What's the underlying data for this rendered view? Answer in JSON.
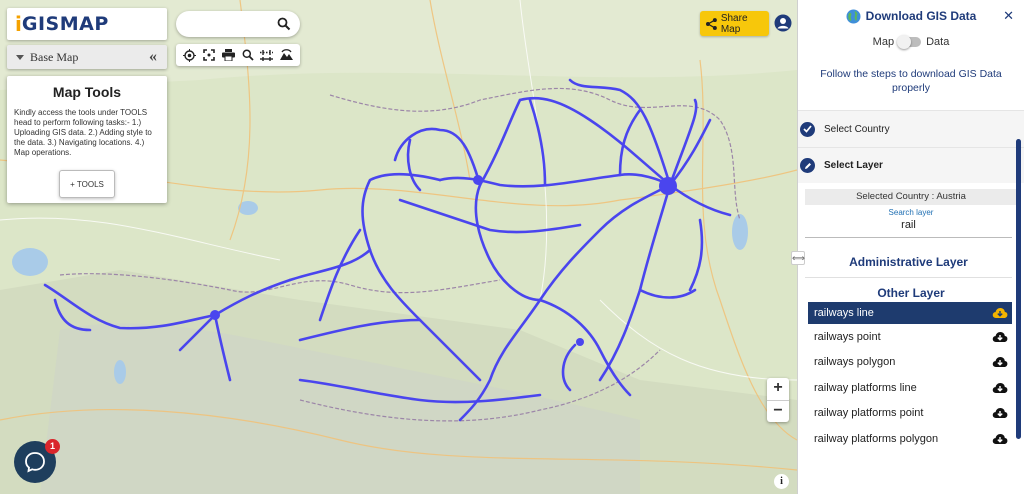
{
  "logo": {
    "mark": "i",
    "text": "GISMAP"
  },
  "base_map": {
    "label": "Base Map",
    "collapse_glyph": "«"
  },
  "map_tools": {
    "title": "Map Tools",
    "description": "Kindly access the tools under TOOLS head to perform following tasks:- 1.) Uploading GIS data. 2.) Adding style to the data. 3.) Navigating locations. 4.) Map operations.",
    "button_label": "+ TOOLS"
  },
  "search": {
    "placeholder": "",
    "value": ""
  },
  "toolbar": {
    "icons": [
      "locate-icon",
      "fullscreen-icon",
      "print-icon",
      "zoom-search-icon",
      "measure-icon",
      "terrain-icon"
    ]
  },
  "share": {
    "label": "Share Map"
  },
  "zoom": {
    "in": "+",
    "out": "−"
  },
  "info": "i",
  "chat": {
    "badge": "1"
  },
  "panel": {
    "title": "Download GIS Data",
    "toggle_left": "Map",
    "toggle_right": "Data",
    "instructions": "Follow the steps to download GIS Data properly",
    "steps": [
      {
        "label": "Select Country",
        "status": "done"
      },
      {
        "label": "Select Layer",
        "status": "active"
      }
    ],
    "selected_country": "Selected Country : Austria",
    "search_layer_label": "Search layer",
    "search_layer_value": "rail",
    "admin_heading": "Administrative Layer",
    "other_heading": "Other Layer",
    "layers": [
      {
        "label": "railways line",
        "active": true
      },
      {
        "label": "railways point",
        "active": false
      },
      {
        "label": "railways polygon",
        "active": false
      },
      {
        "label": "railway platforms line",
        "active": false
      },
      {
        "label": "railway platforms point",
        "active": false
      },
      {
        "label": "railway platforms polygon",
        "active": false
      }
    ]
  },
  "colors": {
    "accent": "#1f3b7a",
    "share": "#f7c70b",
    "rail": "#4a45ee",
    "active_row": "#1e3b6e",
    "download_active": "#f5b400"
  }
}
